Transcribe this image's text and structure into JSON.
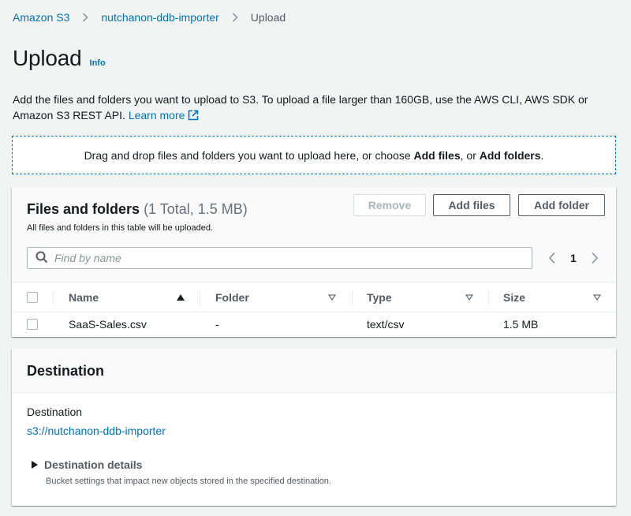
{
  "breadcrumb": {
    "items": [
      {
        "label": "Amazon S3",
        "link": true
      },
      {
        "label": "nutchanon-ddb-importer",
        "link": true
      },
      {
        "label": "Upload",
        "link": false
      }
    ]
  },
  "header": {
    "title": "Upload",
    "info_label": "Info"
  },
  "description": {
    "text": "Add the files and folders you want to upload to S3. To upload a file larger than 160GB, use the AWS CLI, AWS SDK or Amazon S3 REST API.",
    "learn_more": "Learn more",
    "icon": "external-link-icon"
  },
  "dropzone": {
    "prefix": "Drag and drop files and folders you want to upload here, or choose ",
    "add_files": "Add files",
    "middle": ", or ",
    "add_folders": "Add folders",
    "suffix": "."
  },
  "files_panel": {
    "title": "Files and folders",
    "count": "(1 Total, 1.5 MB)",
    "subtitle": "All files and folders in this table will be uploaded.",
    "buttons": {
      "remove": "Remove",
      "add_files": "Add files",
      "add_folder": "Add folder"
    },
    "search": {
      "placeholder": "Find by name",
      "value": ""
    },
    "pagination": {
      "current_page": "1"
    },
    "table": {
      "columns": [
        {
          "label": "Name",
          "sort": "ascending"
        },
        {
          "label": "Folder",
          "sort": "none"
        },
        {
          "label": "Type",
          "sort": "none"
        },
        {
          "label": "Size",
          "sort": "none"
        }
      ],
      "rows": [
        {
          "name": "SaaS-Sales.csv",
          "folder": "-",
          "type": "text/csv",
          "size": "1.5 MB",
          "selected": false
        }
      ]
    }
  },
  "destination_panel": {
    "title": "Destination",
    "label": "Destination",
    "link": "s3://nutchanon-ddb-importer",
    "details_title": "Destination details",
    "details_subtitle": "Bucket settings that impact new objects stored in the specified destination."
  },
  "colors": {
    "background": "#f2f3f3",
    "link": "#0073bb",
    "text": "#16191f",
    "secondary_text": "#545b64",
    "disabled": "#aab7b8"
  }
}
